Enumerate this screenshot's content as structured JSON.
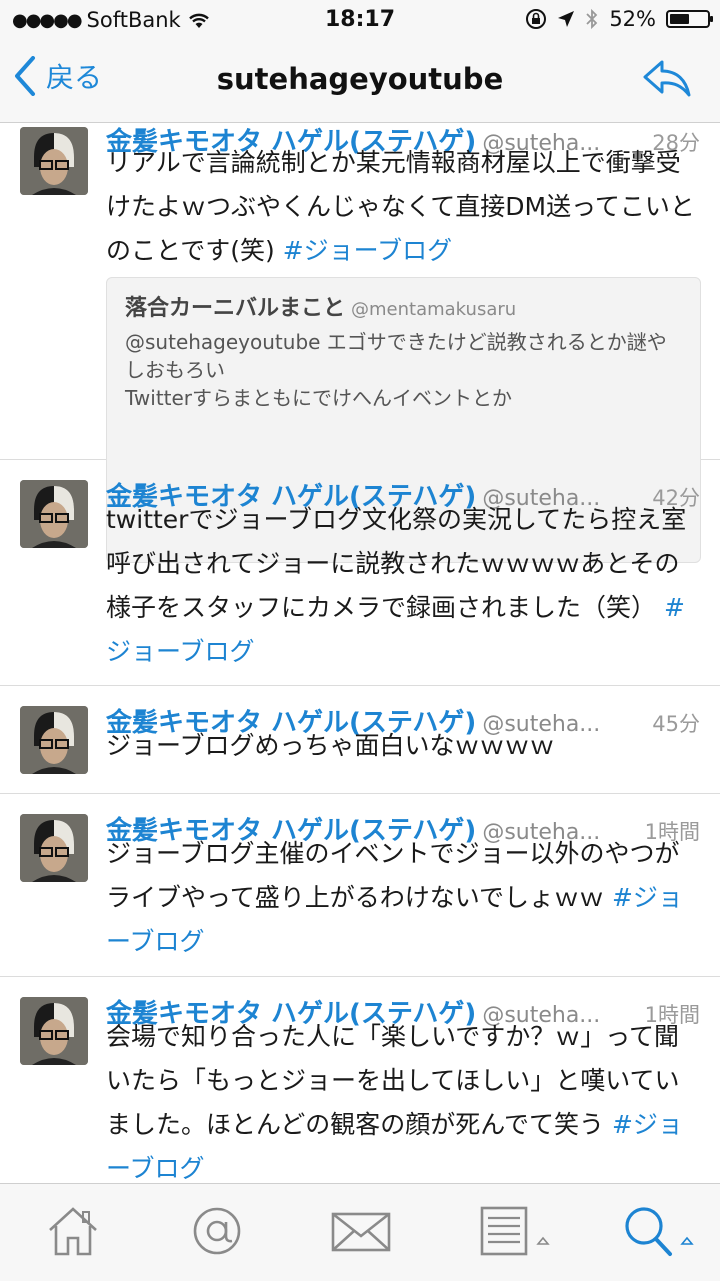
{
  "status_bar": {
    "carrier": "SoftBank",
    "time": "18:17",
    "battery": "52%",
    "battery_level": 0.52
  },
  "nav": {
    "back_label": "戻る",
    "title": "sutehageyoutube"
  },
  "tweets": [
    {
      "name": "金髪キモオタ ハゲル(ステハゲ)",
      "handle": "@suteha...",
      "time": "28分",
      "text": "リアルで言論統制とか某元情報商材屋以上で衝撃受けたよｗつぶやくんじゃなくて直接DM送ってこいとのことです(笑) ",
      "hashtag": "#ジョーブログ",
      "quote": {
        "name": "落合カーニバルまこと",
        "handle": "@mentamakusaru",
        "line1": "@sutehageyoutube エゴサできたけど説教されるとか謎やしおもろい",
        "line2": "Twitterすらまともにでけへんイベントとか"
      }
    },
    {
      "name": "金髪キモオタ ハゲル(ステハゲ)",
      "handle": "@suteha...",
      "time": "42分",
      "text": "twitterでジョーブログ文化祭の実況してたら控え室呼び出されてジョーに説教されたｗｗｗｗあとその様子をスタッフにカメラで録画されました（笑） ",
      "hashtag": "#ジョーブログ"
    },
    {
      "name": "金髪キモオタ ハゲル(ステハゲ)",
      "handle": "@suteha...",
      "time": "45分",
      "text": "ジョーブログめっちゃ面白いなｗｗｗｗ",
      "hashtag": ""
    },
    {
      "name": "金髪キモオタ ハゲル(ステハゲ)",
      "handle": "@suteha...",
      "time": "1時間",
      "text": "ジョーブログ主催のイベントでジョー以外のやつがライブやって盛り上がるわけないでしょｗｗ ",
      "hashtag": "#ジョーブログ"
    },
    {
      "name": "金髪キモオタ ハゲル(ステハゲ)",
      "handle": "@suteha...",
      "time": "1時間",
      "text": "会場で知り合った人に「楽しいですか？ｗ」って聞いたら「もっとジョーを出してほしい」と嘆いていました。ほとんどの観客の顔が死んでて笑う ",
      "hashtag": "#ジョーブログ"
    }
  ],
  "tabbar": {
    "icons": [
      "home-icon",
      "mentions-icon",
      "messages-icon",
      "lists-icon",
      "search-icon"
    ]
  },
  "colors": {
    "accent": "#1d84d2",
    "bar_bg": "#f7f7f7"
  }
}
